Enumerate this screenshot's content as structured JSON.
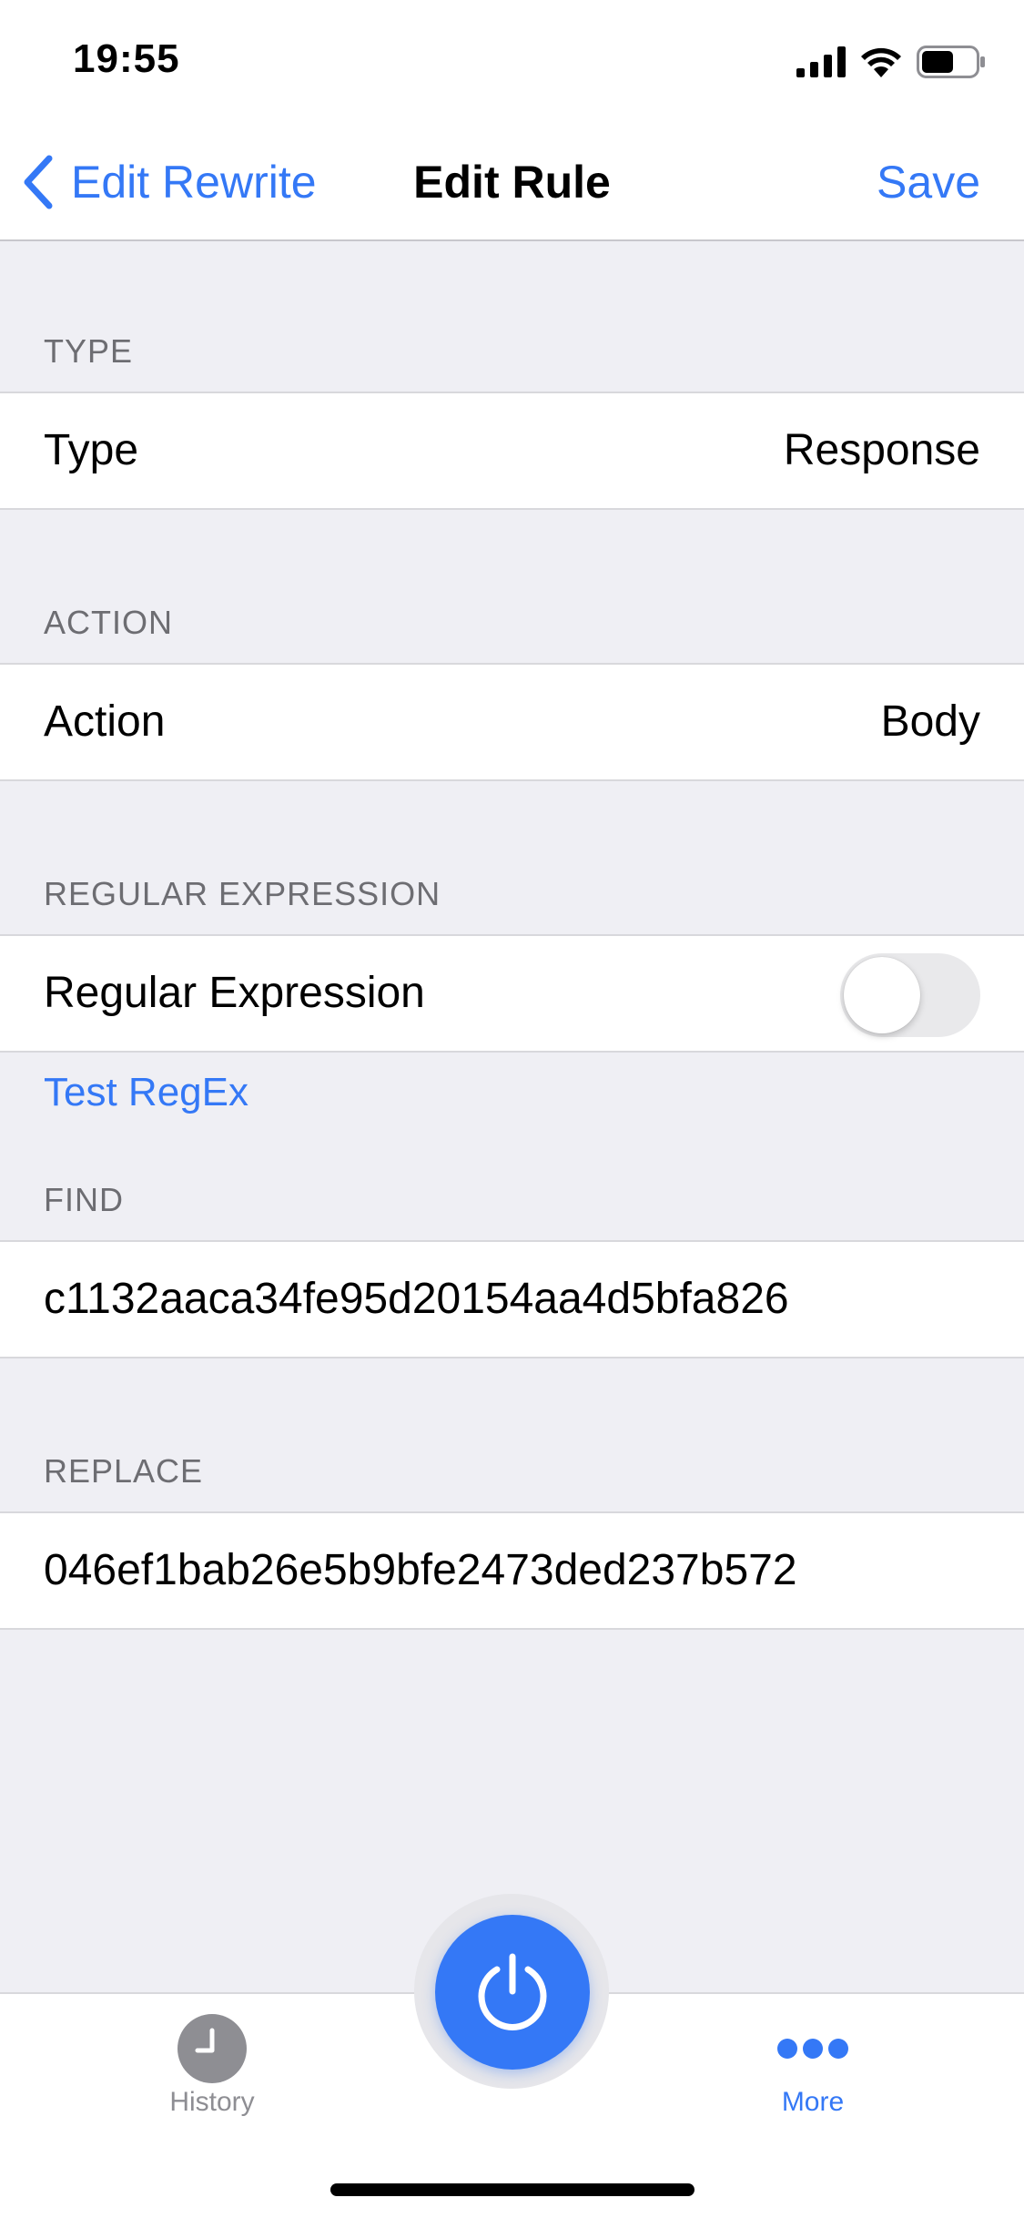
{
  "status_bar": {
    "time": "19:55"
  },
  "nav": {
    "back_label": "Edit Rewrite",
    "title": "Edit Rule",
    "save_label": "Save"
  },
  "sections": {
    "type": {
      "header": "TYPE",
      "label": "Type",
      "value": "Response"
    },
    "action": {
      "header": "ACTION",
      "label": "Action",
      "value": "Body"
    },
    "regex": {
      "header": "REGULAR EXPRESSION",
      "label": "Regular Expression",
      "enabled": false,
      "test_link": "Test RegEx"
    },
    "find": {
      "header": "FIND",
      "value": "c1132aaca34fe95d20154aa4d5bfa826"
    },
    "replace": {
      "header": "REPLACE",
      "value": "046ef1bab26e5b9bfe2473ded237b572"
    }
  },
  "tab_bar": {
    "history": {
      "label": "History",
      "icon": "clock-icon"
    },
    "power": {
      "icon": "power-icon"
    },
    "more": {
      "label": "More",
      "icon": "more-dots-icon"
    }
  },
  "colors": {
    "accent": "#3478f6",
    "background": "#efeff4",
    "inactive": "#8e8e93"
  }
}
